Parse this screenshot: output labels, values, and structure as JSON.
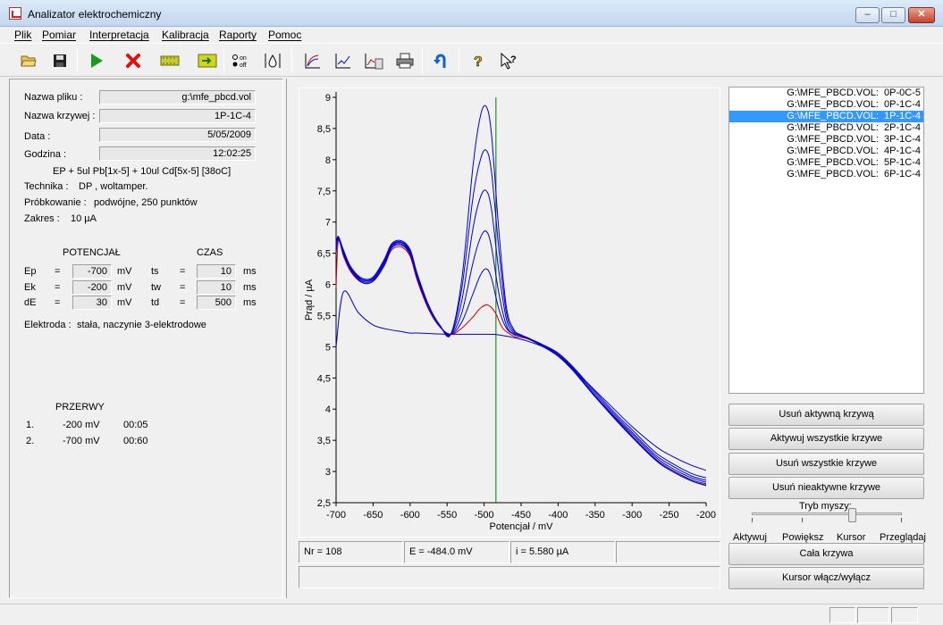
{
  "window": {
    "title": "Analizator elektrochemiczny"
  },
  "menu": [
    "Plik",
    "Pomiar",
    "Interpretacja",
    "Kalibracja",
    "Raporty",
    "Pomoc"
  ],
  "toolbar": [
    "open-folder-icon",
    "save-icon",
    "play-icon",
    "stop-icon",
    "film-icon",
    "export-icon",
    "on-off-icon",
    "drop-icon",
    "chart-curves-icon",
    "chart-line-icon",
    "chart-calc-icon",
    "print-icon",
    "undo-icon",
    "help-icon",
    "whats-this-icon"
  ],
  "info": {
    "file_label": "Nazwa pliku :",
    "file": "g:\\mfe_pbcd.vol",
    "curve_label": "Nazwa krzywej :",
    "curve": "1P-1C-4",
    "date_label": "Data :",
    "date": "5/05/2009",
    "time_label": "Godzina :",
    "time": "12:02:25",
    "description": "EP + 5ul Pb[1x-5] + 10ul Cd[5x-5] [38oC]",
    "technique_label": "Technika :",
    "technique": "DP , woltamper.",
    "sampling_label": "Próbkowanie :",
    "sampling": "podwójne, 250 punktów",
    "range_label": "Zakres :",
    "range": "10 µA"
  },
  "params": {
    "potential_header": "POTENCJAŁ",
    "time_header": "CZAS",
    "rows": [
      {
        "name": "Ep",
        "eq": "=",
        "value": "-700",
        "unit": "mV",
        "tname": "ts",
        "teq": "=",
        "tvalue": "10",
        "tunit": "ms"
      },
      {
        "name": "Ek",
        "eq": "=",
        "value": "-200",
        "unit": "mV",
        "tname": "tw",
        "teq": "=",
        "tvalue": "10",
        "tunit": "ms"
      },
      {
        "name": "dE",
        "eq": "=",
        "value": "30",
        "unit": "mV",
        "tname": "td",
        "teq": "=",
        "tvalue": "500",
        "tunit": "ms"
      }
    ],
    "electrode_label": "Elektroda :",
    "electrode": "stała, naczynie 3-elektrodowe"
  },
  "breaks": {
    "header": "PRZERWY",
    "rows": [
      {
        "n": "1.",
        "potential": "-200 mV",
        "time": "00:05"
      },
      {
        "n": "2.",
        "potential": "-700 mV",
        "time": "00:60"
      }
    ]
  },
  "status": {
    "nr": "Nr = 108",
    "e": "E =  -484.0 mV",
    "i": "i =   5.580 µA"
  },
  "curves_list": [
    {
      "label": "G:\\MFE_PBCD.VOL:  0P-0C-5",
      "active": false
    },
    {
      "label": "G:\\MFE_PBCD.VOL:  0P-1C-4",
      "active": false
    },
    {
      "label": "G:\\MFE_PBCD.VOL:  1P-1C-4",
      "active": true
    },
    {
      "label": "G:\\MFE_PBCD.VOL:  2P-1C-4",
      "active": false
    },
    {
      "label": "G:\\MFE_PBCD.VOL:  3P-1C-4",
      "active": false
    },
    {
      "label": "G:\\MFE_PBCD.VOL:  4P-1C-4",
      "active": false
    },
    {
      "label": "G:\\MFE_PBCD.VOL:  5P-1C-4",
      "active": false
    },
    {
      "label": "G:\\MFE_PBCD.VOL:  6P-1C-4",
      "active": false
    }
  ],
  "buttons": {
    "remove_active": "Usuń aktywną krzywą",
    "activate_all": "Aktywuj wszystkie krzywe",
    "remove_all": "Usuń wszystkie krzywe",
    "remove_inactive": "Usuń nieaktywne krzywe",
    "whole_curve": "Cała krzywa",
    "cursor_toggle": "Kursor włącz/wyłącz"
  },
  "mouse_mode": {
    "label": "Tryb myszy:",
    "options": [
      "Aktywuj",
      "Powiększ",
      "Kursor",
      "Przeglądaj"
    ],
    "selected": "Kursor"
  },
  "chart_data": {
    "type": "line",
    "xlabel": "Potencjał / mV",
    "ylabel": "Prąd / µA",
    "xlim": [
      -700,
      -200
    ],
    "ylim": [
      2.5,
      9
    ],
    "xticks": [
      "-700",
      "-650",
      "-600",
      "-550",
      "-500",
      "-450",
      "-400",
      "-350",
      "-300",
      "-250",
      "-200"
    ],
    "yticks": [
      "2,5",
      "3",
      "3,5",
      "4",
      "4,5",
      "5",
      "5,5",
      "6",
      "6,5",
      "7",
      "7,5",
      "8",
      "8,5",
      "9"
    ],
    "cursor_x": -484,
    "colors": {
      "blue": "#0000cc",
      "red": "#cc0000",
      "cursor": "#007700"
    },
    "series": [
      {
        "color": "#0000cc",
        "x": [
          -700,
          -690,
          -670,
          -650,
          -630,
          -610,
          -600,
          -590,
          -570,
          -550,
          -530,
          -500,
          -480,
          -450,
          -420,
          -400,
          -380,
          -350,
          -320,
          -300,
          -270,
          -250,
          -220,
          -200
        ],
        "y": [
          5.0,
          5.88,
          5.55,
          5.35,
          5.28,
          5.24,
          5.22,
          5.22,
          5.21,
          5.2,
          5.2,
          5.2,
          5.19,
          5.12,
          5.0,
          4.88,
          4.65,
          4.3,
          3.95,
          3.72,
          3.42,
          3.27,
          3.1,
          3.02
        ]
      },
      {
        "color": "#cc0000",
        "x": [
          -700,
          -697,
          -690,
          -680,
          -665,
          -650,
          -635,
          -625,
          -612,
          -600,
          -590,
          -575,
          -560,
          -545,
          -530,
          -515,
          -505,
          -495,
          -485,
          -475,
          -460,
          -450,
          -440,
          -420,
          -400,
          -380,
          -350,
          -320,
          -300,
          -270,
          -250,
          -220,
          -200
        ],
        "y": [
          5.95,
          6.7,
          6.45,
          6.2,
          6.03,
          6.05,
          6.3,
          6.55,
          6.6,
          6.45,
          6.05,
          5.6,
          5.32,
          5.2,
          5.3,
          5.48,
          5.62,
          5.67,
          5.55,
          5.3,
          5.17,
          5.15,
          5.12,
          5.0,
          4.85,
          4.62,
          4.2,
          3.8,
          3.55,
          3.2,
          3.03,
          2.85,
          2.77
        ]
      },
      {
        "color": "#0000cc",
        "x": [
          -700,
          -697,
          -690,
          -680,
          -665,
          -650,
          -635,
          -625,
          -612,
          -600,
          -590,
          -575,
          -560,
          -545,
          -530,
          -515,
          -505,
          -497,
          -490,
          -480,
          -470,
          -460,
          -450,
          -440,
          -420,
          -400,
          -380,
          -350,
          -320,
          -300,
          -270,
          -250,
          -220,
          -200
        ],
        "y": [
          6.5,
          6.73,
          6.48,
          6.22,
          6.03,
          6.05,
          6.3,
          6.58,
          6.63,
          6.48,
          6.08,
          5.62,
          5.33,
          5.2,
          5.4,
          5.85,
          6.15,
          6.25,
          6.1,
          5.6,
          5.3,
          5.2,
          5.17,
          5.13,
          5.0,
          4.85,
          4.62,
          4.2,
          3.8,
          3.55,
          3.2,
          3.03,
          2.85,
          2.78
        ]
      },
      {
        "color": "#0000cc",
        "x": [
          -700,
          -697,
          -690,
          -680,
          -665,
          -650,
          -635,
          -625,
          -612,
          -600,
          -590,
          -575,
          -560,
          -545,
          -530,
          -515,
          -505,
          -497,
          -490,
          -480,
          -470,
          -460,
          -450,
          -440,
          -420,
          -400,
          -380,
          -350,
          -320,
          -300,
          -270,
          -250,
          -220,
          -200
        ],
        "y": [
          6.55,
          6.74,
          6.5,
          6.24,
          6.05,
          6.07,
          6.32,
          6.6,
          6.65,
          6.5,
          6.1,
          5.63,
          5.33,
          5.2,
          5.55,
          6.35,
          6.75,
          6.85,
          6.6,
          5.85,
          5.35,
          5.2,
          5.17,
          5.13,
          5.0,
          4.85,
          4.62,
          4.2,
          3.82,
          3.57,
          3.22,
          3.05,
          2.87,
          2.8
        ]
      },
      {
        "color": "#0000cc",
        "x": [
          -700,
          -697,
          -690,
          -680,
          -665,
          -650,
          -635,
          -625,
          -612,
          -600,
          -590,
          -575,
          -560,
          -545,
          -530,
          -515,
          -505,
          -497,
          -490,
          -480,
          -470,
          -460,
          -450,
          -440,
          -420,
          -400,
          -380,
          -350,
          -320,
          -300,
          -270,
          -250,
          -220,
          -200
        ],
        "y": [
          6.6,
          6.75,
          6.52,
          6.25,
          6.07,
          6.09,
          6.35,
          6.62,
          6.67,
          6.52,
          6.12,
          5.65,
          5.34,
          5.2,
          5.75,
          6.9,
          7.4,
          7.5,
          7.2,
          6.2,
          5.45,
          5.22,
          5.17,
          5.13,
          5.0,
          4.87,
          4.64,
          4.22,
          3.84,
          3.6,
          3.25,
          3.08,
          2.9,
          2.83
        ]
      },
      {
        "color": "#0000cc",
        "x": [
          -700,
          -697,
          -690,
          -680,
          -665,
          -650,
          -635,
          -625,
          -612,
          -600,
          -590,
          -575,
          -560,
          -545,
          -530,
          -515,
          -505,
          -497,
          -490,
          -480,
          -470,
          -460,
          -450,
          -440,
          -420,
          -400,
          -380,
          -350,
          -320,
          -300,
          -270,
          -250,
          -220,
          -200
        ],
        "y": [
          6.62,
          6.76,
          6.53,
          6.27,
          6.08,
          6.1,
          6.37,
          6.63,
          6.68,
          6.54,
          6.14,
          5.66,
          5.35,
          5.2,
          5.95,
          7.4,
          8.0,
          8.15,
          7.8,
          6.55,
          5.55,
          5.25,
          5.18,
          5.13,
          5.02,
          4.88,
          4.66,
          4.25,
          3.87,
          3.63,
          3.28,
          3.12,
          2.93,
          2.86
        ]
      },
      {
        "color": "#0000cc",
        "x": [
          -700,
          -697,
          -690,
          -680,
          -665,
          -650,
          -635,
          -625,
          -612,
          -600,
          -590,
          -575,
          -560,
          -545,
          -530,
          -515,
          -505,
          -497,
          -490,
          -480,
          -470,
          -460,
          -450,
          -440,
          -420,
          -400,
          -380,
          -350,
          -320,
          -300,
          -270,
          -250,
          -220,
          -200
        ],
        "y": [
          6.65,
          6.77,
          6.55,
          6.28,
          6.1,
          6.12,
          6.4,
          6.65,
          6.7,
          6.56,
          6.16,
          5.67,
          5.35,
          5.2,
          6.1,
          7.9,
          8.7,
          8.85,
          8.4,
          6.85,
          5.65,
          5.28,
          5.19,
          5.14,
          5.03,
          4.9,
          4.68,
          4.28,
          3.9,
          3.67,
          3.32,
          3.16,
          2.97,
          2.9
        ]
      }
    ]
  }
}
